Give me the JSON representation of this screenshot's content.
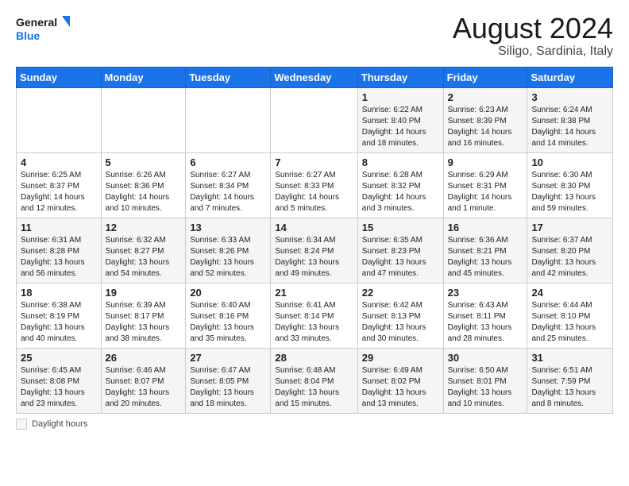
{
  "header": {
    "logo_general": "General",
    "logo_blue": "Blue",
    "month_year": "August 2024",
    "location": "Siligo, Sardinia, Italy"
  },
  "weekdays": [
    "Sunday",
    "Monday",
    "Tuesday",
    "Wednesday",
    "Thursday",
    "Friday",
    "Saturday"
  ],
  "weeks": [
    [
      {
        "day": "",
        "info": ""
      },
      {
        "day": "",
        "info": ""
      },
      {
        "day": "",
        "info": ""
      },
      {
        "day": "",
        "info": ""
      },
      {
        "day": "1",
        "info": "Sunrise: 6:22 AM\nSunset: 8:40 PM\nDaylight: 14 hours\nand 18 minutes."
      },
      {
        "day": "2",
        "info": "Sunrise: 6:23 AM\nSunset: 8:39 PM\nDaylight: 14 hours\nand 16 minutes."
      },
      {
        "day": "3",
        "info": "Sunrise: 6:24 AM\nSunset: 8:38 PM\nDaylight: 14 hours\nand 14 minutes."
      }
    ],
    [
      {
        "day": "4",
        "info": "Sunrise: 6:25 AM\nSunset: 8:37 PM\nDaylight: 14 hours\nand 12 minutes."
      },
      {
        "day": "5",
        "info": "Sunrise: 6:26 AM\nSunset: 8:36 PM\nDaylight: 14 hours\nand 10 minutes."
      },
      {
        "day": "6",
        "info": "Sunrise: 6:27 AM\nSunset: 8:34 PM\nDaylight: 14 hours\nand 7 minutes."
      },
      {
        "day": "7",
        "info": "Sunrise: 6:27 AM\nSunset: 8:33 PM\nDaylight: 14 hours\nand 5 minutes."
      },
      {
        "day": "8",
        "info": "Sunrise: 6:28 AM\nSunset: 8:32 PM\nDaylight: 14 hours\nand 3 minutes."
      },
      {
        "day": "9",
        "info": "Sunrise: 6:29 AM\nSunset: 8:31 PM\nDaylight: 14 hours\nand 1 minute."
      },
      {
        "day": "10",
        "info": "Sunrise: 6:30 AM\nSunset: 8:30 PM\nDaylight: 13 hours\nand 59 minutes."
      }
    ],
    [
      {
        "day": "11",
        "info": "Sunrise: 6:31 AM\nSunset: 8:28 PM\nDaylight: 13 hours\nand 56 minutes."
      },
      {
        "day": "12",
        "info": "Sunrise: 6:32 AM\nSunset: 8:27 PM\nDaylight: 13 hours\nand 54 minutes."
      },
      {
        "day": "13",
        "info": "Sunrise: 6:33 AM\nSunset: 8:26 PM\nDaylight: 13 hours\nand 52 minutes."
      },
      {
        "day": "14",
        "info": "Sunrise: 6:34 AM\nSunset: 8:24 PM\nDaylight: 13 hours\nand 49 minutes."
      },
      {
        "day": "15",
        "info": "Sunrise: 6:35 AM\nSunset: 8:23 PM\nDaylight: 13 hours\nand 47 minutes."
      },
      {
        "day": "16",
        "info": "Sunrise: 6:36 AM\nSunset: 8:21 PM\nDaylight: 13 hours\nand 45 minutes."
      },
      {
        "day": "17",
        "info": "Sunrise: 6:37 AM\nSunset: 8:20 PM\nDaylight: 13 hours\nand 42 minutes."
      }
    ],
    [
      {
        "day": "18",
        "info": "Sunrise: 6:38 AM\nSunset: 8:19 PM\nDaylight: 13 hours\nand 40 minutes."
      },
      {
        "day": "19",
        "info": "Sunrise: 6:39 AM\nSunset: 8:17 PM\nDaylight: 13 hours\nand 38 minutes."
      },
      {
        "day": "20",
        "info": "Sunrise: 6:40 AM\nSunset: 8:16 PM\nDaylight: 13 hours\nand 35 minutes."
      },
      {
        "day": "21",
        "info": "Sunrise: 6:41 AM\nSunset: 8:14 PM\nDaylight: 13 hours\nand 33 minutes."
      },
      {
        "day": "22",
        "info": "Sunrise: 6:42 AM\nSunset: 8:13 PM\nDaylight: 13 hours\nand 30 minutes."
      },
      {
        "day": "23",
        "info": "Sunrise: 6:43 AM\nSunset: 8:11 PM\nDaylight: 13 hours\nand 28 minutes."
      },
      {
        "day": "24",
        "info": "Sunrise: 6:44 AM\nSunset: 8:10 PM\nDaylight: 13 hours\nand 25 minutes."
      }
    ],
    [
      {
        "day": "25",
        "info": "Sunrise: 6:45 AM\nSunset: 8:08 PM\nDaylight: 13 hours\nand 23 minutes."
      },
      {
        "day": "26",
        "info": "Sunrise: 6:46 AM\nSunset: 8:07 PM\nDaylight: 13 hours\nand 20 minutes."
      },
      {
        "day": "27",
        "info": "Sunrise: 6:47 AM\nSunset: 8:05 PM\nDaylight: 13 hours\nand 18 minutes."
      },
      {
        "day": "28",
        "info": "Sunrise: 6:48 AM\nSunset: 8:04 PM\nDaylight: 13 hours\nand 15 minutes."
      },
      {
        "day": "29",
        "info": "Sunrise: 6:49 AM\nSunset: 8:02 PM\nDaylight: 13 hours\nand 13 minutes."
      },
      {
        "day": "30",
        "info": "Sunrise: 6:50 AM\nSunset: 8:01 PM\nDaylight: 13 hours\nand 10 minutes."
      },
      {
        "day": "31",
        "info": "Sunrise: 6:51 AM\nSunset: 7:59 PM\nDaylight: 13 hours\nand 8 minutes."
      }
    ]
  ],
  "legend": {
    "daylight_label": "Daylight hours"
  }
}
